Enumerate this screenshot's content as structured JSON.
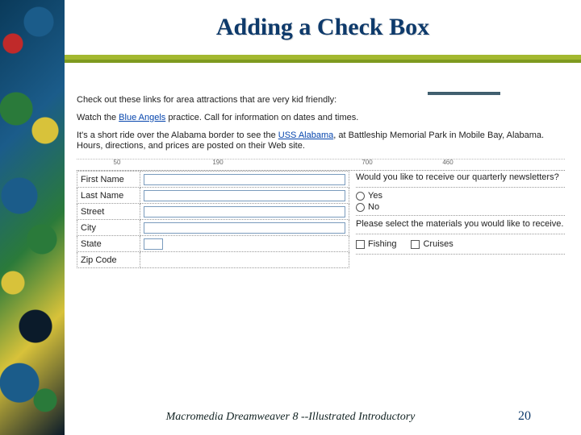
{
  "title": "Adding a Check Box",
  "photoAlt": "scenic photo corner",
  "body": {
    "introLine": "Check out these links for area attractions that are very kid friendly:",
    "line2a": "Watch the ",
    "link1": "Blue Angels",
    "line2b": " practice. Call for information on dates and times.",
    "line3a": "It's a short ride over the Alabama border to see the ",
    "link2": "USS Alabama",
    "line3b": ", at Battleship Memorial Park in Mobile Bay, Alabama. Hours, directions, and prices are posted on their Web site.",
    "rulerMarks": {
      "r1": "50",
      "r2": "190",
      "r3": "700",
      "r4": "460"
    }
  },
  "form": {
    "labels": {
      "firstName": "First Name",
      "lastName": "Last Name",
      "street": "Street",
      "city": "City",
      "state": "State",
      "zip": "Zip Code"
    },
    "newsletterQuestion": "Would you like to receive our quarterly newsletters?",
    "yes": "Yes",
    "no": "No",
    "materialsPrompt": "Please select the materials you would like to receive.",
    "fishing": "Fishing",
    "cruises": "Cruises"
  },
  "footer": "Macromedia Dreamweaver 8 --Illustrated Introductory",
  "pageNumber": "20"
}
